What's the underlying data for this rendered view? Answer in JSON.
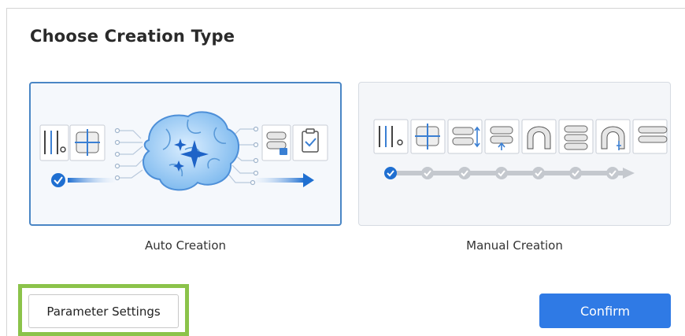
{
  "dialog": {
    "title": "Choose Creation Type"
  },
  "options": [
    {
      "label": "Auto Creation",
      "selected": true
    },
    {
      "label": "Manual Creation",
      "selected": false
    }
  ],
  "manual_steps": {
    "total": 7,
    "completed": 1
  },
  "footer": {
    "parameter_settings_label": "Parameter Settings",
    "confirm_label": "Confirm"
  },
  "colors": {
    "accent": "#2f7ae5",
    "selected_border": "#4a86c5",
    "highlight": "#8bc34a"
  },
  "icons": {
    "auto": [
      "tools-icon",
      "segmentation-icon",
      "brain-icon",
      "sparkle-icon",
      "aligner-model-icon",
      "checklist-icon",
      "check-icon",
      "arrow-right-icon"
    ],
    "manual": [
      "tools-icon",
      "segmentation-icon",
      "teeth-movement-icon",
      "model-upload-icon",
      "arch-icon",
      "aligner-model-icon",
      "arch-select-icon",
      "aligner-icon",
      "check-icon",
      "arrow-right-icon"
    ]
  }
}
